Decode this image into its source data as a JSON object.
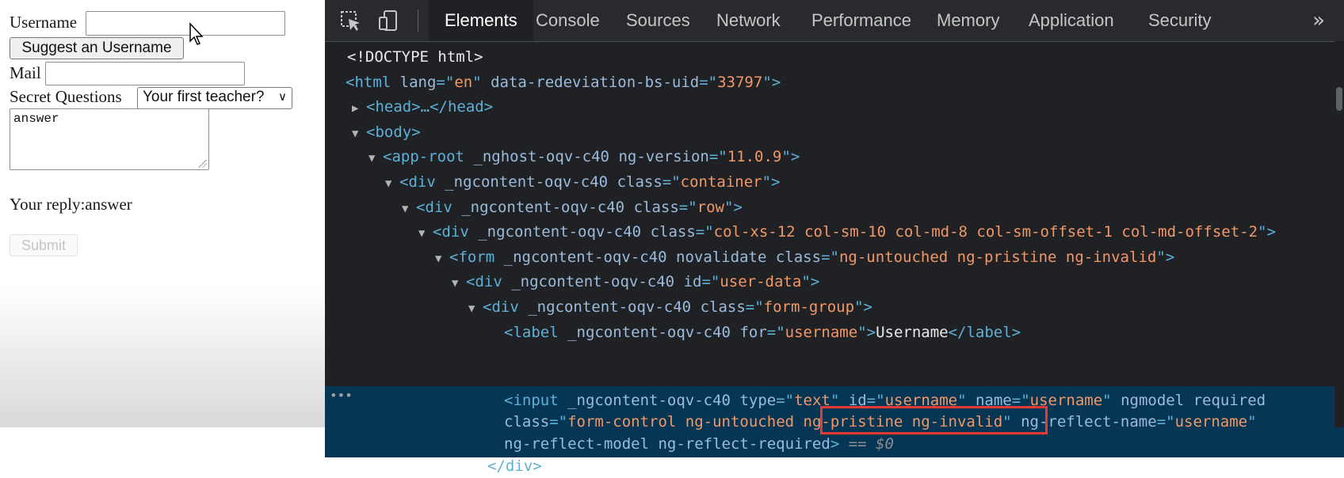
{
  "form": {
    "username_label": "Username",
    "username_value": "",
    "suggest_button": "Suggest an Username",
    "mail_label": "Mail",
    "mail_value": "",
    "secret_label": "Secret Questions",
    "secret_selected": "Your first teacher?",
    "answer_text": "answer",
    "reply_label": "Your reply:answer",
    "submit_label": "Submit"
  },
  "devtools": {
    "tabs": [
      {
        "label": "Elements",
        "active": true
      },
      {
        "label": "Console",
        "active": false
      },
      {
        "label": "Sources",
        "active": false
      },
      {
        "label": "Network",
        "active": false
      },
      {
        "label": "Performance",
        "active": false
      },
      {
        "label": "Memory",
        "active": false
      },
      {
        "label": "Application",
        "active": false
      },
      {
        "label": "Security",
        "active": false
      }
    ],
    "more_icon": "chevron-double-right-icon",
    "select_icon": "inspect-element-icon",
    "device_icon": "device-toolbar-icon",
    "selection_marker": "== $0",
    "dots": "•••"
  },
  "dom_lines": [
    {
      "text": "<!DOCTYPE html>"
    },
    {
      "tag": "html",
      "attrs": [
        [
          "lang",
          "en"
        ],
        [
          "data-redeviation-bs-uid",
          "33797"
        ]
      ]
    },
    {
      "collapsed": "<head>…</head>"
    },
    {
      "tag": "body"
    },
    {
      "tag": "app-root",
      "attrs": [
        [
          "_nghost-oqv-c40",
          null
        ],
        [
          "ng-version",
          "11.0.9"
        ]
      ]
    },
    {
      "tag": "div",
      "attrs": [
        [
          "_ngcontent-oqv-c40",
          null
        ],
        [
          "class",
          "container"
        ]
      ]
    },
    {
      "tag": "div",
      "attrs": [
        [
          "_ngcontent-oqv-c40",
          null
        ],
        [
          "class",
          "row"
        ]
      ]
    },
    {
      "tag": "div",
      "attrs": [
        [
          "_ngcontent-oqv-c40",
          null
        ],
        [
          "class",
          "col-xs-12 col-sm-10 col-md-8 col-sm-offset-1 col-md-offset-2"
        ]
      ]
    },
    {
      "tag": "form",
      "attrs": [
        [
          "_ngcontent-oqv-c40",
          null
        ],
        [
          "novalidate",
          null
        ],
        [
          "class",
          "ng-untouched ng-pristine ng-invalid"
        ]
      ]
    },
    {
      "tag": "div",
      "attrs": [
        [
          "_ngcontent-oqv-c40",
          null
        ],
        [
          "id",
          "user-data"
        ]
      ]
    },
    {
      "tag": "div",
      "attrs": [
        [
          "_ngcontent-oqv-c40",
          null
        ],
        [
          "class",
          "form-group"
        ]
      ]
    },
    {
      "label_line": {
        "attrs": [
          [
            "_ngcontent-oqv-c40",
            null
          ],
          [
            "for",
            "username"
          ]
        ],
        "content": "Username"
      }
    }
  ],
  "selected_node": {
    "line1": {
      "tag": "input",
      "attrs": [
        [
          "_ngcontent-oqv-c40",
          null
        ],
        [
          "type",
          "text"
        ],
        [
          "id",
          "username"
        ],
        [
          "name",
          "username"
        ],
        [
          "ngmodel",
          null
        ],
        [
          "required",
          null
        ]
      ]
    },
    "line2_class_prefix": "form-control ng-untouched ",
    "line2_class_highlight": "ng-pristine ng-invalid",
    "line2_after_attr": "ng-reflect-name",
    "line2_after_val": "username",
    "line3": "ng-reflect-model ng-reflect-required",
    "closing_partial": "</div>"
  },
  "colors": {
    "devtools_bg": "#202124",
    "tag": "#5db0d7",
    "attr": "#9bbbdc",
    "value": "#f29766",
    "selected_bg": "#073655",
    "highlight_box": "#e53935"
  }
}
